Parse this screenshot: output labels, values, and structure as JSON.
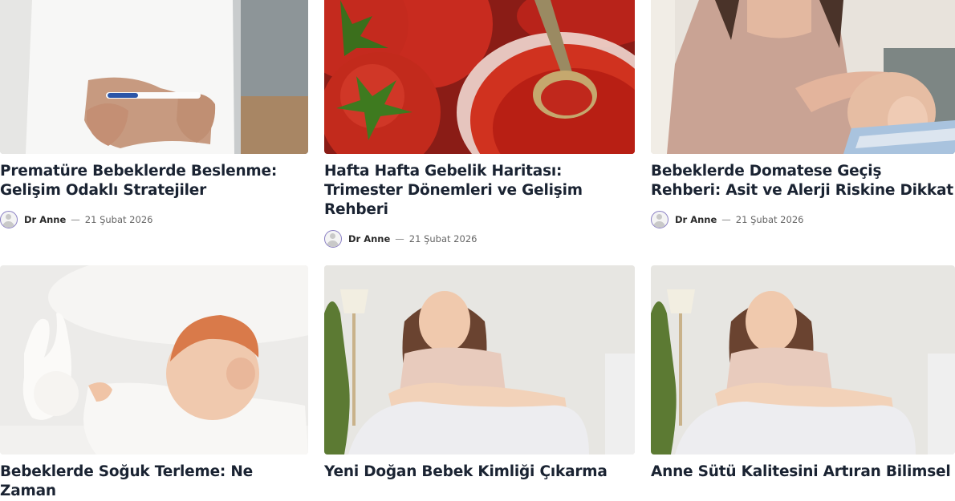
{
  "posts": [
    {
      "title": "Prematüre Bebeklerde Beslenme: Gelişim Odaklı Stratejiler",
      "author": "Dr Anne",
      "separator": "—",
      "date": "21 Şubat 2026",
      "image": "woman-with-pregnancy-test"
    },
    {
      "title": "Hafta Hafta Gebelik Haritası: Trimester Dönemleri ve Gelişim Rehberi",
      "author": "Dr Anne",
      "separator": "—",
      "date": "21 Şubat 2026",
      "image": "tomatoes-and-tomato-paste"
    },
    {
      "title": "Bebeklerde Domatese Geçiş Rehberi: Asit ve Alerji Riskine Dikkat",
      "author": "Dr Anne",
      "separator": "—",
      "date": "21 Şubat 2026",
      "image": "mother-touching-baby-forehead"
    },
    {
      "title": "Bebeklerde Soğuk Terleme: Ne Zaman",
      "image": "sleeping-baby-with-bunny"
    },
    {
      "title": "Yeni Doğan Bebek Kimliği Çıkarma",
      "image": "mother-breastfeeding"
    },
    {
      "title": "Anne Sütü Kalitesini Artıran Bilimsel",
      "image": "mother-breastfeeding"
    }
  ]
}
